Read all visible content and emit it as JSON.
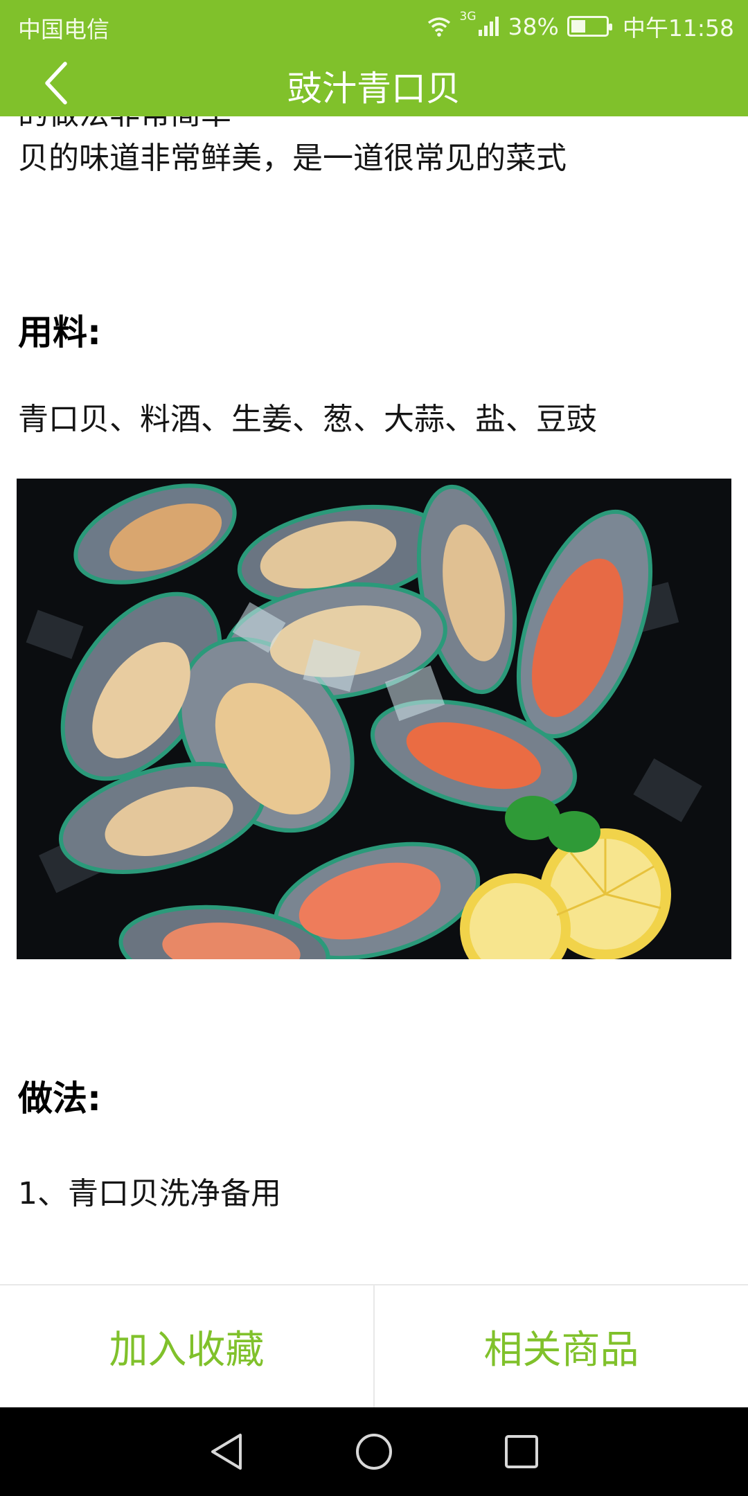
{
  "status_bar": {
    "carrier": "中国电信",
    "network": "3G",
    "battery": "38%",
    "time": "中午11:58"
  },
  "app_bar": {
    "title": "豉汁青口贝",
    "back_icon": "chevron-left-icon"
  },
  "article": {
    "intro_partial": "的做法非常简单",
    "intro_line2": "贝的味道非常鲜美，是一道很常见的菜式",
    "ingredients_heading": "用料:",
    "ingredients": "青口贝、料酒、生姜、葱、大蒜、盐、豆豉",
    "method_heading": "做法:",
    "steps": [
      "1、青口贝洗净备用"
    ]
  },
  "actions": {
    "favorite": "加入收藏",
    "related": "相关商品"
  },
  "nav_bar": {
    "back": "triangle-back-icon",
    "home": "circle-home-icon",
    "recents": "square-recents-icon"
  },
  "colors": {
    "accent": "#80c12b",
    "nav_bar": "#000000"
  }
}
